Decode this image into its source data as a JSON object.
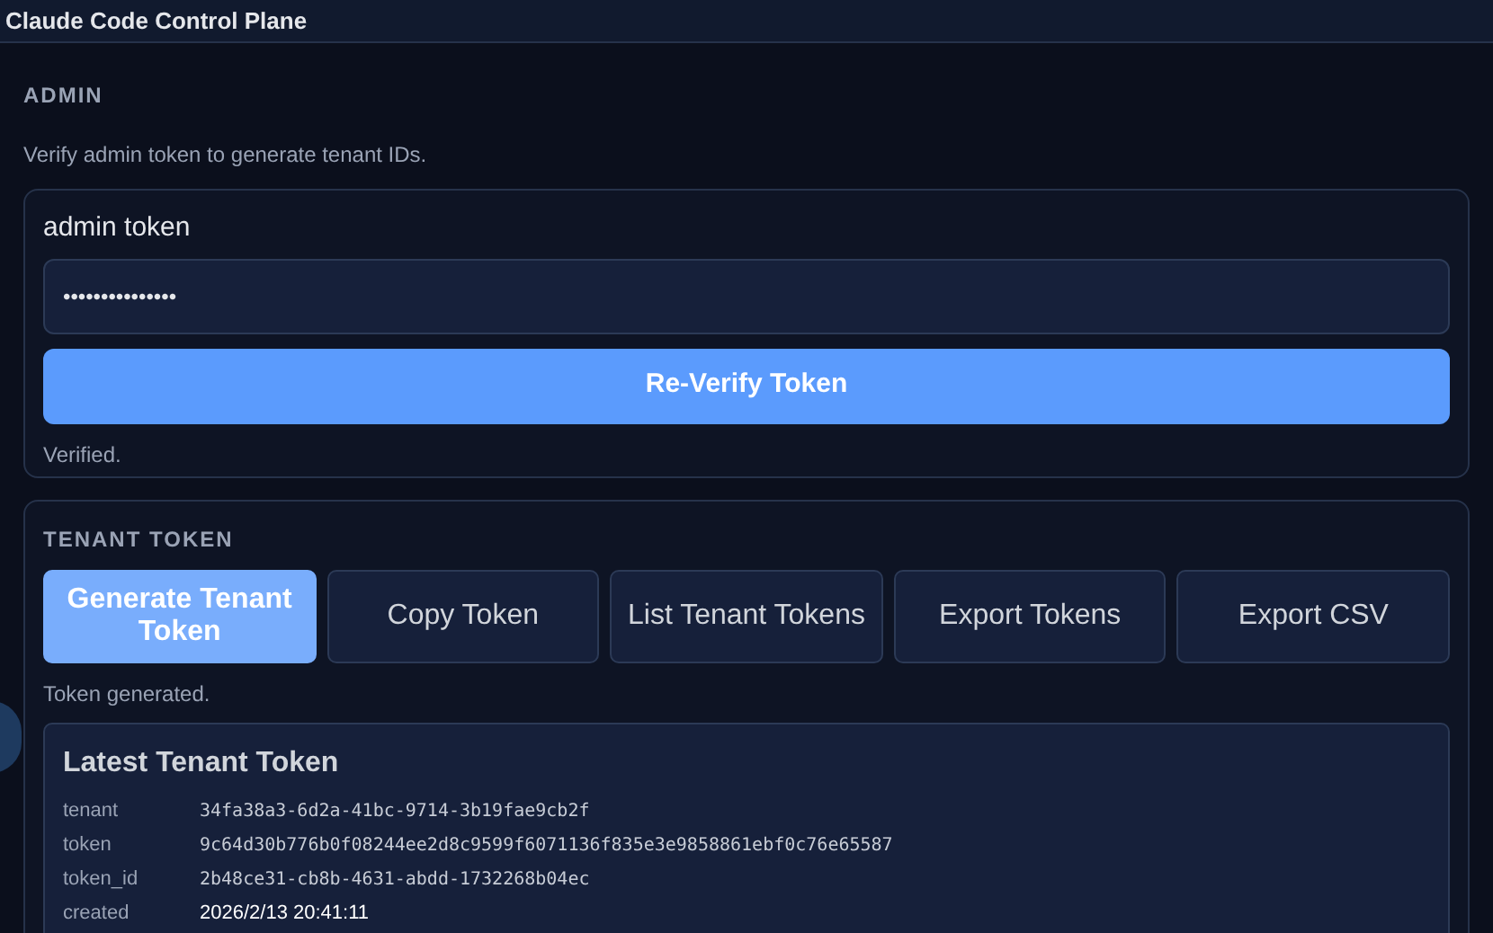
{
  "window": {
    "title": "Claude Code Control Plane"
  },
  "admin": {
    "heading": "ADMIN",
    "description": "Verify admin token to generate tenant IDs.",
    "field_label": "admin token",
    "token_value": "•••••••••••••••",
    "verify_button": "Re-Verify Token",
    "status": "Verified."
  },
  "tenant": {
    "heading": "TENANT TOKEN",
    "buttons": [
      {
        "label": "Generate Tenant Token",
        "kind": "primary"
      },
      {
        "label": "Copy Token",
        "kind": "secondary"
      },
      {
        "label": "List Tenant Tokens",
        "kind": "secondary"
      },
      {
        "label": "Export Tokens",
        "kind": "secondary"
      },
      {
        "label": "Export CSV",
        "kind": "secondary"
      }
    ],
    "status": "Token generated.",
    "latest": {
      "title": "Latest Tenant Token",
      "rows": [
        {
          "key": "tenant",
          "value": "34fa38a3-6d2a-41bc-9714-3b19fae9cb2f",
          "kind": "mono"
        },
        {
          "key": "token",
          "value": "9c64d30b776b0f08244ee2d8c9599f6071136f835e3e9858861ebf0c76e65587",
          "kind": "mono"
        },
        {
          "key": "token_id",
          "value": "2b48ce31-cb8b-4631-abdd-1732268b04ec",
          "kind": "mono"
        },
        {
          "key": "created",
          "value": "2026/2/13 20:41:11",
          "kind": "plain"
        }
      ]
    }
  }
}
